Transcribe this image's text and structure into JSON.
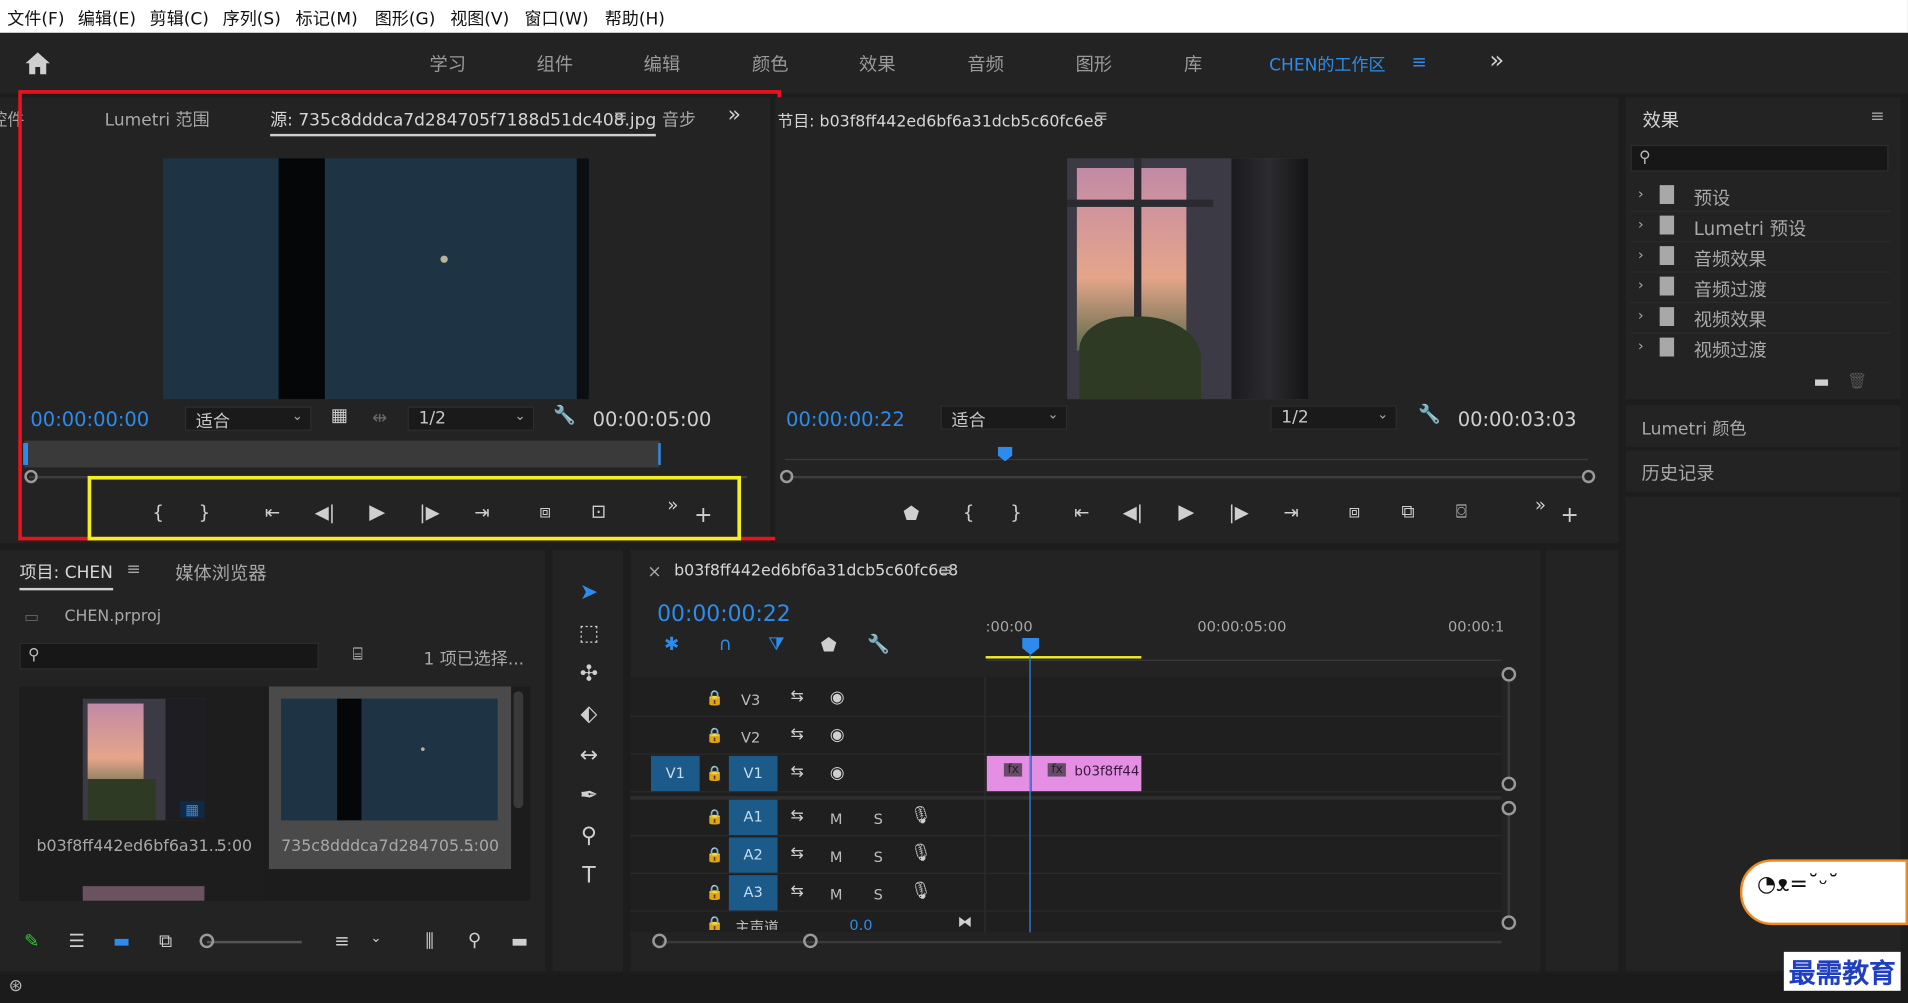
{
  "menubar": {
    "items": [
      "文件(F)",
      "编辑(E)",
      "剪辑(C)",
      "序列(S)",
      "标记(M)",
      "图形(G)",
      "视图(V)",
      "窗口(W)",
      "帮助(H)"
    ]
  },
  "workspace": {
    "tabs": [
      "学习",
      "组件",
      "编辑",
      "颜色",
      "效果",
      "音频",
      "图形",
      "库"
    ],
    "active": "CHEN的工作区",
    "menu_icon": "≡",
    "more_icon": "»"
  },
  "source": {
    "tabs": [
      "控件",
      "Lumetri 范围",
      "源: 735c8dddca7d284705f7188d51dc408.jpg",
      "音步"
    ],
    "tab_menu": "≡",
    "more": "»",
    "timecode_in": "00:00:00:00",
    "fit": "适合",
    "resolution": "1/2",
    "duration": "00:00:05:00"
  },
  "program": {
    "title": "节目: b03f8ff442ed6bf6a31dcb5c60fc6e8",
    "menu": "≡",
    "timecode": "00:00:00:22",
    "fit": "适合",
    "resolution": "1/2",
    "duration": "00:00:03:03"
  },
  "effects": {
    "title": "效果",
    "menu": "≡",
    "items": [
      "预设",
      "Lumetri 预设",
      "音频效果",
      "音频过渡",
      "视频效果",
      "视频过渡"
    ],
    "lumetri_color": "Lumetri 颜色",
    "history": "历史记录"
  },
  "project": {
    "tab": "项目: CHEN",
    "tab_menu": "≡",
    "media_browser": "媒体浏览器",
    "file": "CHEN.prproj",
    "selection": "1 项已选择...",
    "clips": [
      {
        "name": "b03f8ff442ed6bf6a31...",
        "duration": "5:00"
      },
      {
        "name": "735c8dddca7d284705...",
        "duration": "5:00"
      }
    ]
  },
  "timeline": {
    "close": "×",
    "title": "b03f8ff442ed6bf6a31dcb5c60fc6e8",
    "menu": "≡",
    "timecode": "00:00:00:22",
    "ruler_labels": [
      ":00:00",
      "00:00:05:00",
      "00:00:1"
    ],
    "video_tracks": [
      "V3",
      "V2",
      "V1"
    ],
    "audio_tracks": [
      "A1",
      "A2",
      "A3"
    ],
    "source_v": "V1",
    "mix_label": "主声道",
    "mix_value": "0.0",
    "m_label": "M",
    "s_label": "S",
    "clip_label": "b03f8ff44",
    "fx_badge": "fx"
  },
  "watermark": {
    "text": "最需教育"
  },
  "colors": {
    "accent_blue": "#2d8ceb",
    "red_frame": "#e8131c",
    "yellow_frame": "#f2ee22",
    "clip_pink": "#e48fe4"
  }
}
